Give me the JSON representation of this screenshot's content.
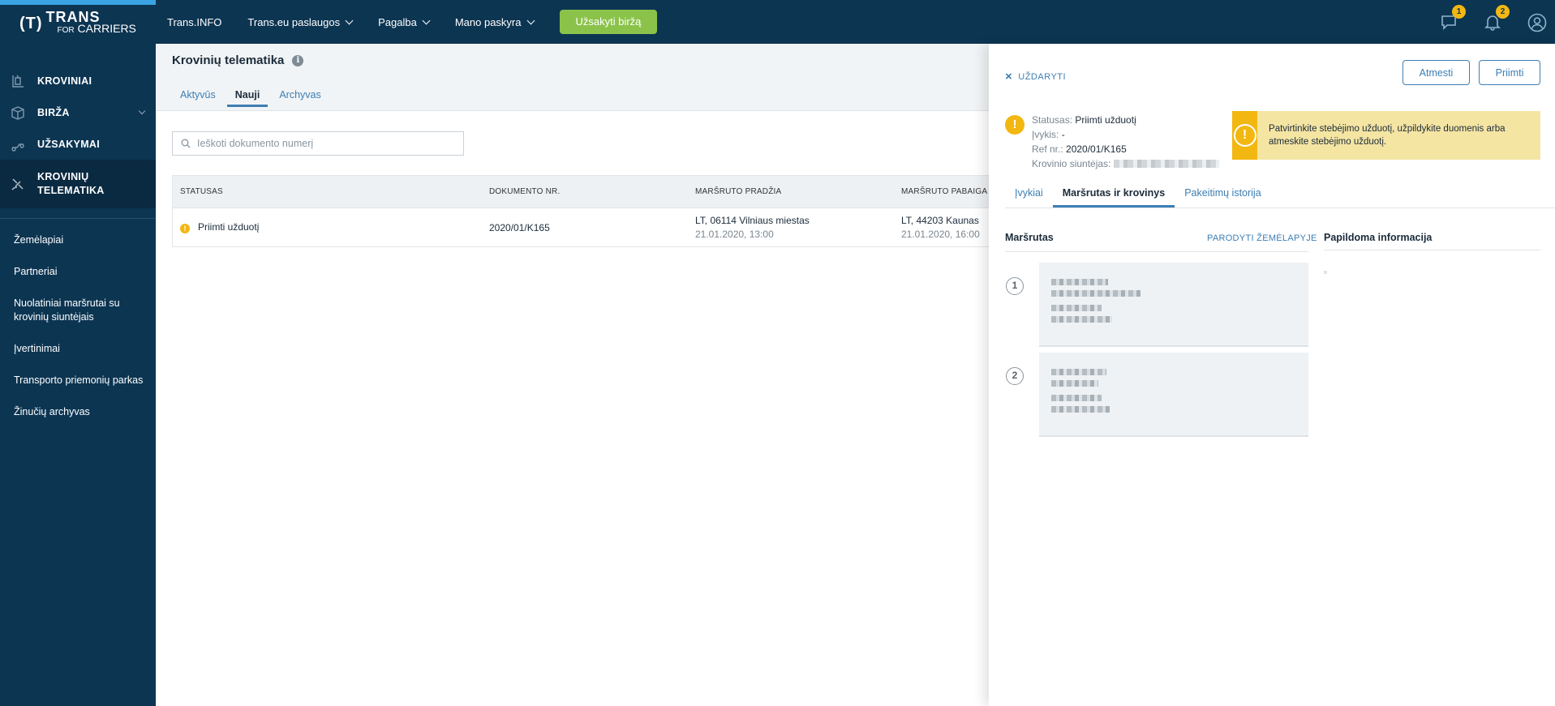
{
  "logo": {
    "badge": "(T)",
    "line1": "TRANS",
    "line2_small": "FOR",
    "line2": "CARRIERS"
  },
  "topnav": {
    "items": [
      {
        "label": "Trans.INFO",
        "has_dropdown": false
      },
      {
        "label": "Trans.eu paslaugos",
        "has_dropdown": true
      },
      {
        "label": "Pagalba",
        "has_dropdown": true
      },
      {
        "label": "Mano paskyra",
        "has_dropdown": true
      }
    ],
    "cta_label": "Užsakyti biržą",
    "messages_count": "1",
    "notifications_count": "2"
  },
  "sidebar": {
    "main_items": [
      {
        "label": "KROVINIAI",
        "icon": "cargo-icon"
      },
      {
        "label": "BIRŽA",
        "icon": "box-icon",
        "has_dropdown": true
      },
      {
        "label": "UŽSAKYMAI",
        "icon": "orders-icon"
      },
      {
        "label": "KROVINIŲ TELEMATIKA",
        "icon": "satellite-icon",
        "active": true
      }
    ],
    "sub_items": [
      "Žemėlapiai",
      "Partneriai",
      "Nuolatiniai maršrutai su krovinių siuntėjais",
      "Įvertinimai",
      "Transporto priemonių parkas",
      "Žinučių archyvas"
    ]
  },
  "main": {
    "title": "Krovinių telematika",
    "tabs": [
      {
        "label": "Aktyvūs",
        "active": false
      },
      {
        "label": "Nauji",
        "active": true
      },
      {
        "label": "Archyvas",
        "active": false
      }
    ],
    "search_placeholder": "Ieškoti dokumento numerį",
    "table": {
      "headers": [
        "STATUSAS",
        "DOKUMENTO NR.",
        "MARŠRUTO PRADŽIA",
        "MARŠRUTO PABAIGA"
      ],
      "rows": [
        {
          "status": "Priimti užduotį",
          "document": "2020/01/K165",
          "start_place": "LT, 06114 Vilniaus miestas",
          "start_time": "21.01.2020, 13:00",
          "end_place": "LT, 44203 Kaunas",
          "end_time": "21.01.2020, 16:00"
        }
      ]
    }
  },
  "panel": {
    "close_label": "UŽDARYTI",
    "reject_label": "Atmesti",
    "accept_label": "Priimti",
    "status_label": "Statusas:",
    "status_value": "Priimti užduotį",
    "event_label": "Įvykis:",
    "event_value": "-",
    "ref_label": "Ref nr.:",
    "ref_value": "2020/01/K165",
    "sender_label": "Krovinio siuntėjas:",
    "alert_text": "Patvirtinkite stebėjimo užduotį, užpildykite duomenis arba atmeskite stebėjimo užduotį.",
    "tabs": [
      {
        "label": "Įvykiai",
        "active": false
      },
      {
        "label": "Maršrutas ir krovinys",
        "active": true
      },
      {
        "label": "Pakeitimų istorija",
        "active": false
      }
    ],
    "route_heading": "Maršrutas",
    "show_map_label": "PARODYTI ŽEMĖLAPYJE",
    "extra_heading": "Papildoma informacija",
    "stops": [
      {
        "number": "1"
      },
      {
        "number": "2"
      }
    ]
  },
  "colors": {
    "navy": "#0c3552",
    "accent_blue": "#3d7eb3",
    "green": "#8bc34a",
    "warning": "#f3b711",
    "alert_bg": "#f5e5a3"
  }
}
